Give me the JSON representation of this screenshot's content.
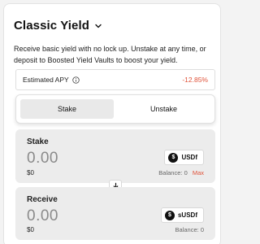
{
  "header": {
    "title": "Classic Yield"
  },
  "description": "Receive basic yield with no lock up. Unstake at any time, or deposit to Boosted Yield Vaults to boost your yield.",
  "apy": {
    "label": "Estimated APY",
    "value": "-12.85%"
  },
  "tabs": [
    {
      "label": "Stake"
    },
    {
      "label": "Unstake"
    }
  ],
  "stake": {
    "label": "Stake",
    "amount": "0.00",
    "usd_value": "$0",
    "token": "USDf",
    "balance_label": "Balance:",
    "balance_value": "0",
    "max_label": "Max"
  },
  "receive": {
    "label": "Receive",
    "amount": "0.00",
    "usd_value": "$0",
    "token": "sUSDf",
    "balance_label": "Balance:",
    "balance_value": "0"
  },
  "colors": {
    "negative": "#e0533a",
    "panel_bg": "#ececec"
  },
  "icons": {
    "title_chevron": "chevron-down-icon",
    "info": "info-icon",
    "swap": "arrow-down-icon",
    "usdf": "usdf-token-icon",
    "susdf": "susdf-token-icon"
  }
}
